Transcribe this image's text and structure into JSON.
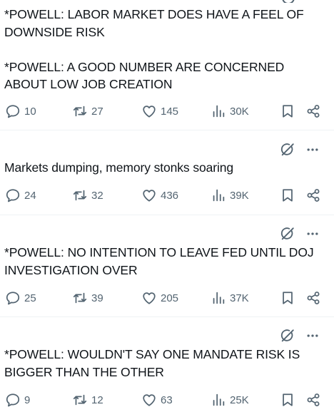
{
  "tweets": [
    {
      "text": "*POWELL: LABOR MARKET DOES HAVE A FEEL OF\nDOWNSIDE RISK\n\n*POWELL: A GOOD NUMBER ARE CONCERNED\nABOUT LOW JOB CREATION",
      "replies": "10",
      "retweets": "27",
      "likes": "145",
      "views": "30K"
    },
    {
      "text": "Markets dumping, memory stonks soaring",
      "replies": "24",
      "retweets": "32",
      "likes": "436",
      "views": "39K"
    },
    {
      "text": "*POWELL: NO INTENTION TO LEAVE FED UNTIL DOJ\nINVESTIGATION OVER",
      "replies": "25",
      "retweets": "39",
      "likes": "205",
      "views": "37K"
    },
    {
      "text": "*POWELL: WOULDN'T SAY ONE MANDATE RISK IS\nBIGGER THAN THE OTHER",
      "replies": "9",
      "retweets": "12",
      "likes": "63",
      "views": "25K"
    }
  ],
  "icons": {
    "reply": "speech-bubble-icon",
    "retweet": "retweet-arrows-icon",
    "like": "heart-icon",
    "views": "bar-chart-icon",
    "bookmark": "bookmark-icon",
    "share": "share-nodes-icon",
    "grok": "grok-slash-circle-icon",
    "more": "more-dots-icon"
  },
  "colors": {
    "text": "#0f1419",
    "muted": "#536471",
    "divider": "#eff3f4"
  }
}
